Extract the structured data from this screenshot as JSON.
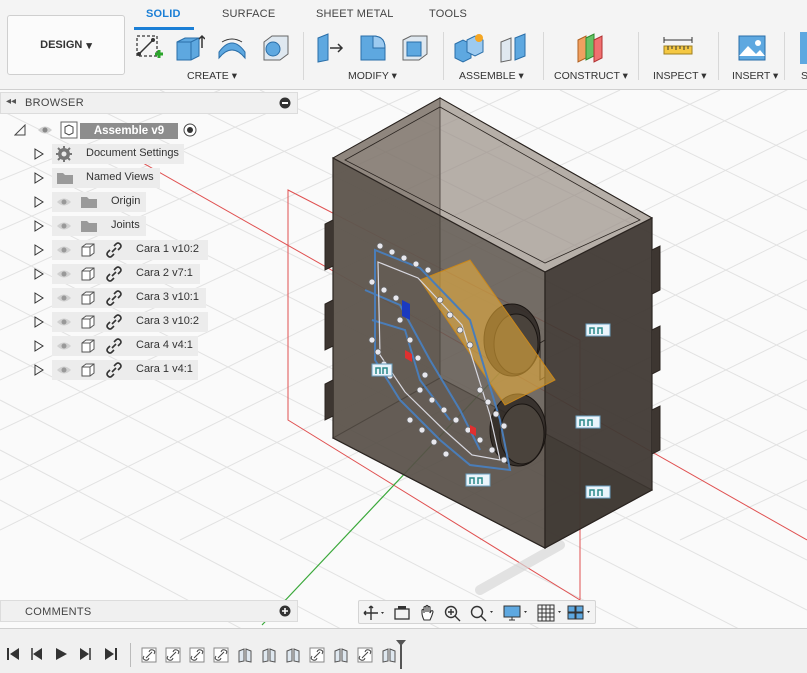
{
  "workspace": {
    "label": "DESIGN"
  },
  "tabs": [
    "SOLID",
    "SURFACE",
    "SHEET METAL",
    "TOOLS"
  ],
  "groups": [
    "CREATE",
    "MODIFY",
    "ASSEMBLE",
    "CONSTRUCT",
    "INSPECT",
    "INSERT",
    "S"
  ],
  "browser": {
    "title": "BROWSER",
    "root": "Assemble v9",
    "items": [
      {
        "label": "Document Settings",
        "icon": "gear-icon"
      },
      {
        "label": "Named Views",
        "icon": "folder-icon"
      },
      {
        "label": "Origin",
        "icon": "folder-icon"
      },
      {
        "label": "Joints",
        "icon": "folder-icon"
      },
      {
        "label": "Cara 1 v10:2",
        "icon": "component-icon"
      },
      {
        "label": "Cara 2 v7:1",
        "icon": "component-icon"
      },
      {
        "label": "Cara 3 v10:1",
        "icon": "component-icon"
      },
      {
        "label": "Cara 3 v10:2",
        "icon": "component-icon"
      },
      {
        "label": "Cara 4 v4:1",
        "icon": "component-icon"
      },
      {
        "label": "Cara 1 v4:1",
        "icon": "component-icon"
      }
    ]
  },
  "comments": {
    "title": "COMMENTS"
  },
  "colors": {
    "accent": "#1b7fd6",
    "body": "#3a332e",
    "plane": "#f2b53a",
    "pcb_trace": "#4a7db8"
  }
}
